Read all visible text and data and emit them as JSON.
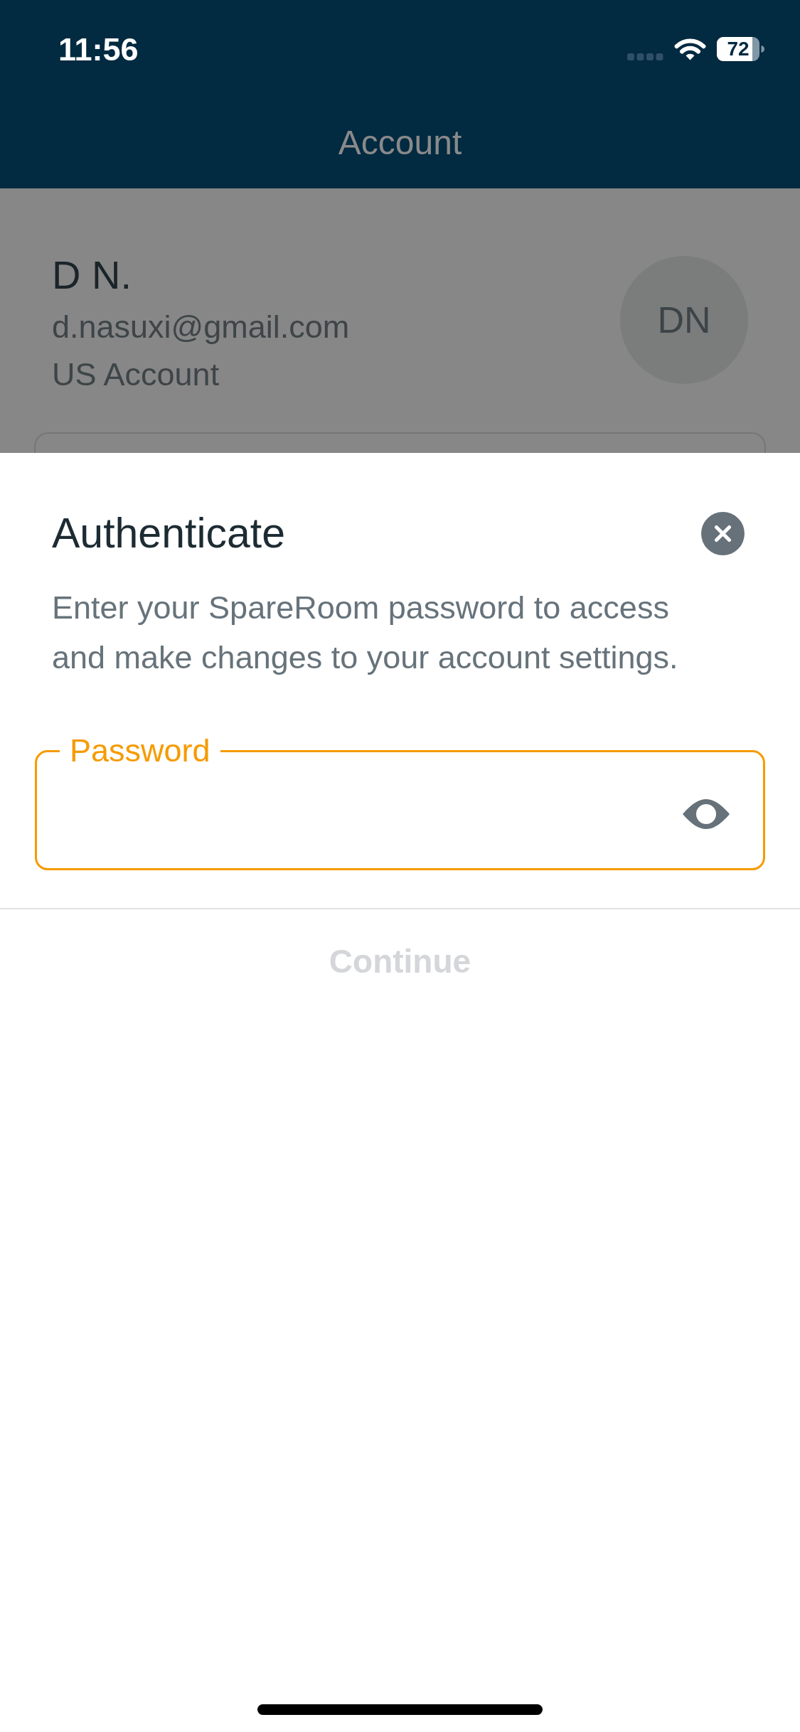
{
  "status_bar": {
    "time": "11:56",
    "battery": "72"
  },
  "header": {
    "title": "Account"
  },
  "profile": {
    "name": "D N.",
    "email": "d.nasuxi@gmail.com",
    "account_type": "US Account",
    "avatar_initials": "DN"
  },
  "auth_sheet": {
    "title": "Authenticate",
    "description": "Enter your SpareRoom password to access and make changes to your account settings.",
    "password_field": {
      "label": "Password",
      "focused": true
    },
    "continue_button": {
      "label": "Continue",
      "disabled": true
    }
  }
}
